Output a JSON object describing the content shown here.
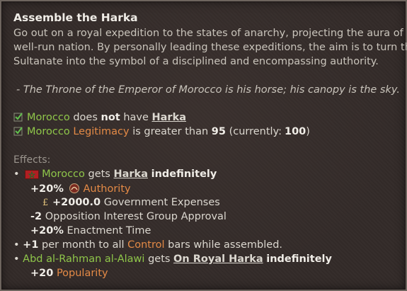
{
  "title": "Assemble the Harka",
  "description": [
    "Go out on a royal expedition to the states of anarchy, projecting the aura of a",
    "well-run nation. By personally leading these expeditions, the aim is to turn the",
    "Sultanate into the symbol of a disciplined and encompassing authority."
  ],
  "flavor": "- The Throne of the Emperor of Morocco is his horse; his canopy is the sky.",
  "requirements": [
    {
      "country": "Morocco",
      "text1": "does",
      "not": "not",
      "text2": "have",
      "link": "Harka"
    },
    {
      "country": "Morocco",
      "stat": "Legitimacy",
      "text1": "is greater than",
      "value": "95",
      "current_label": "(currently:",
      "current": "100",
      "close": ")"
    }
  ],
  "effects_label": "Effects:",
  "effects": {
    "e1": {
      "bullet": "•",
      "country": "Morocco",
      "gets": "gets",
      "link": "Harka",
      "duration": "indefinitely"
    },
    "mods": [
      {
        "value": "+20%",
        "label": "Authority",
        "icon": "authority-icon"
      },
      {
        "value": "+2000.0",
        "label": "Government Expenses",
        "icon": "money-icon"
      },
      {
        "value": "-2",
        "label": "Opposition Interest Group Approval"
      },
      {
        "value": "+20%",
        "label": "Enactment Time"
      }
    ],
    "e2": {
      "bullet": "•",
      "value": "+1",
      "text1": "per month to all",
      "link": "Control",
      "text2": "bars while assembled."
    },
    "e3": {
      "bullet": "•",
      "character": "Abd al-Rahman al-Alawi",
      "gets": "gets",
      "link": "On Royal Harka",
      "duration": "indefinitely"
    },
    "e3mod": {
      "value": "+20",
      "label": "Popularity"
    }
  },
  "colors": {
    "positive": "#5fc65a",
    "negative": "#e0553f",
    "highlight": "#e48a46",
    "country": "#8fc64a"
  }
}
